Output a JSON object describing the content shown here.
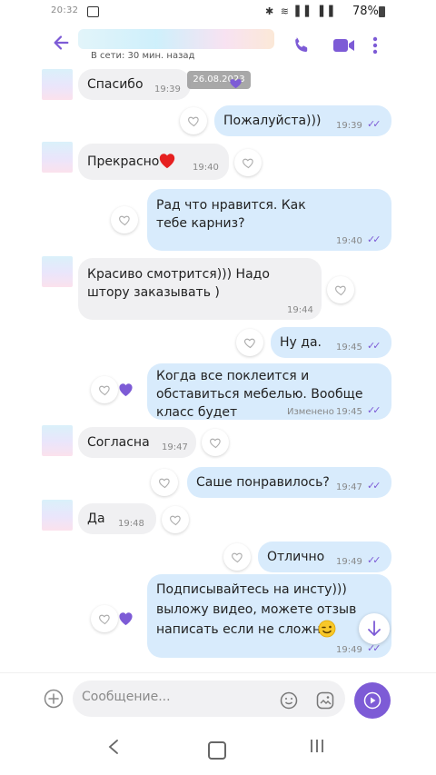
{
  "status": {
    "time": "20:32",
    "icons": "✱ ≋ ▌▌ ▌▌",
    "battery": "78%"
  },
  "header": {
    "presence": "В сети: 30 мин. назад",
    "accent": "#7d5bd6"
  },
  "chat": {
    "date_pill": "26.08.2023",
    "messages": [
      {
        "dir": "in",
        "text": "Спасибо",
        "time": "19:39"
      },
      {
        "dir": "out",
        "text": "Пожалуйста)))",
        "time": "19:39"
      },
      {
        "dir": "in",
        "text": "Прекрасно",
        "time": "19:40"
      },
      {
        "dir": "out",
        "text": "Рад что нравится. Как тебе карниз?",
        "time": "19:40"
      },
      {
        "dir": "in",
        "text": "Красиво смотрится))) Надо штору заказывать )",
        "time": "19:44"
      },
      {
        "dir": "out",
        "text": "Ну да.",
        "time": "19:45"
      },
      {
        "dir": "out",
        "text": "Когда все поклеится и обставиться мебелью. Вообще класс будет",
        "time": "19:45",
        "edited": "Изменено"
      },
      {
        "dir": "in",
        "text": "Согласна",
        "time": "19:47"
      },
      {
        "dir": "out",
        "text": "Саше понравилось?",
        "time": "19:47"
      },
      {
        "dir": "in",
        "text": "Да",
        "time": "19:48"
      },
      {
        "dir": "out",
        "text": "Отлично",
        "time": "19:49"
      },
      {
        "dir": "out",
        "text": "Подписывайтесь на инсту))) выложу видео, можете отзыв написать если не сложно",
        "time": "19:49"
      }
    ]
  },
  "composer": {
    "placeholder": "Сообщение..."
  }
}
